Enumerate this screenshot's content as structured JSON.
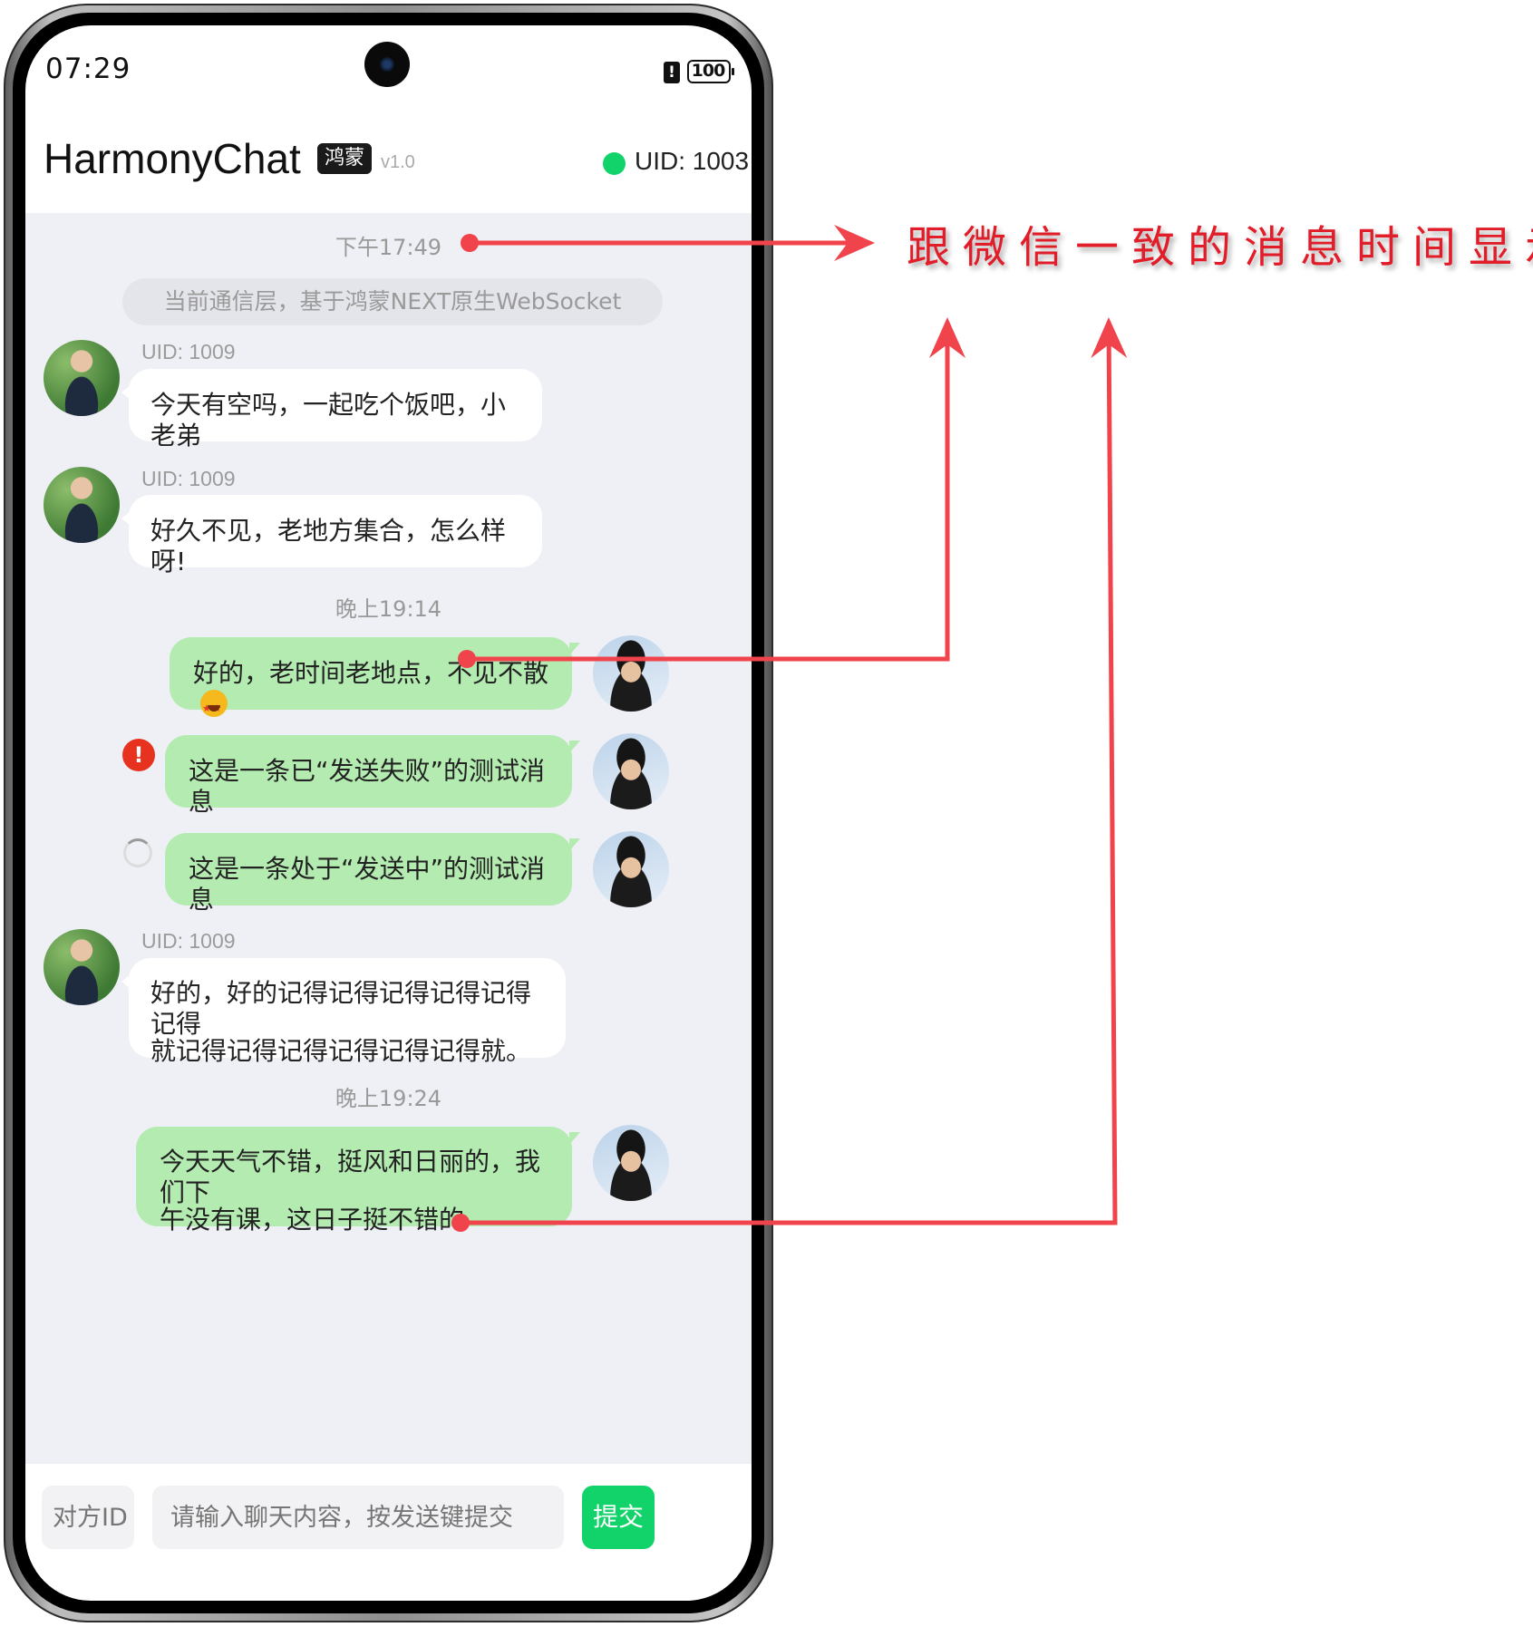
{
  "status_bar": {
    "time": "07:29",
    "battery_level": "100",
    "battery_alert": "!"
  },
  "header": {
    "app_name": "HarmonyChat",
    "badge": "鸿蒙",
    "version": "v1.0",
    "uid_label": "UID: 1003",
    "online_color": "#12d36a"
  },
  "chat": {
    "system_notice": "当前通信层，基于鸿蒙NEXT原生WebSocket",
    "timestamps": [
      "下午17:49",
      "晚上19:14",
      "晚上19:24"
    ],
    "messages": [
      {
        "side": "left",
        "sender": "UID: 1009",
        "text": "今天有空吗，一起吃个饭吧，小老弟"
      },
      {
        "side": "left",
        "sender": "UID: 1009",
        "text": "好久不见，老地方集合，怎么样呀!"
      },
      {
        "side": "right",
        "text": "好的，老时间老地点，不见不散",
        "emoji": "star-struck-emoji"
      },
      {
        "side": "right",
        "status": "failed",
        "text": "这是一条已“发送失败”的测试消息"
      },
      {
        "side": "right",
        "status": "sending",
        "text": "这是一条处于“发送中”的测试消息"
      },
      {
        "side": "left",
        "sender": "UID: 1009",
        "text_line1": "好的，好的记得记得记得记得记得记得",
        "text_line2": "就记得记得记得记得记得记得就。"
      },
      {
        "side": "right",
        "text_line1": "今天天气不错，挺风和日丽的，我们下",
        "text_line2": "午没有课，这日子挺不错的"
      }
    ]
  },
  "input_bar": {
    "peer_id_placeholder": "对方ID",
    "message_placeholder": "请输入聊天内容，按发送键提交",
    "send_label": "提交",
    "send_color": "#12d36a"
  },
  "annotation": {
    "text": "跟微信一致的消息时间显示",
    "color": "#e11d2a"
  }
}
